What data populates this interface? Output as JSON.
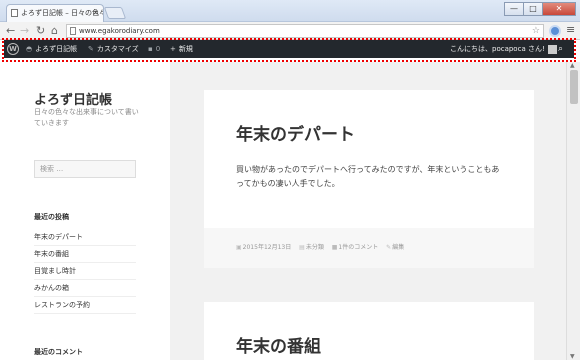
{
  "browser": {
    "tab_title": "よろず日記帳 – 日々の色々な",
    "tab_close": "×",
    "url": "www.egakorodiary.com",
    "win_min": "—",
    "win_max": "□",
    "win_close": "✕"
  },
  "adminbar": {
    "wp_logo": "W",
    "site_name": "よろず日記帳",
    "customize": "カスタマイズ",
    "comments_count": "0",
    "new": "新規",
    "greeting": "こんにちは、pocapoca さん!"
  },
  "sidebar": {
    "site_title": "よろず日記帳",
    "site_description": "日々の色々な出来事について書いていきます",
    "search_placeholder": "検索 …",
    "recent_posts_title": "最近の投稿",
    "recent_posts": [
      "年末のデパート",
      "年末の番組",
      "目覚まし時計",
      "みかんの箱",
      "レストランの予約"
    ],
    "recent_comments_title": "最近のコメント"
  },
  "posts": [
    {
      "title": "年末のデパート",
      "body": "買い物があったのでデパートへ行ってみたのですが、年末ということもあってかもの凄い人手でした。",
      "date": "2015年12月13日",
      "category": "未分類",
      "comments": "1件のコメント",
      "edit": "編集"
    },
    {
      "title": "年末の番組"
    }
  ],
  "colors": {
    "adminbar_bg": "#23282d",
    "highlight": "#e00000",
    "content_bg": "#f1f1f1"
  }
}
